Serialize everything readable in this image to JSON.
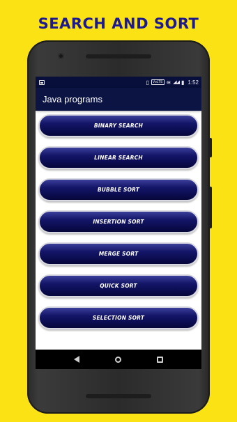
{
  "headline": "SEARCH AND SORT",
  "status_bar": {
    "network_badge": "VoLTE",
    "signal_text": "◢◢",
    "time": "1:52"
  },
  "app_bar": {
    "title": "Java programs"
  },
  "menu": {
    "items": [
      {
        "label": "BINARY SEARCH"
      },
      {
        "label": "LINEAR SEARCH"
      },
      {
        "label": "BUBBLE SORT"
      },
      {
        "label": "INSERTION SORT"
      },
      {
        "label": "MERGE SORT"
      },
      {
        "label": "QUICK SORT"
      },
      {
        "label": "SELECTION SORT"
      }
    ]
  },
  "colors": {
    "background": "#fbe214",
    "headline": "#1c1a8c",
    "status_bar": "#070f3a",
    "app_bar": "#0b1442",
    "button": "#0c0d52"
  }
}
